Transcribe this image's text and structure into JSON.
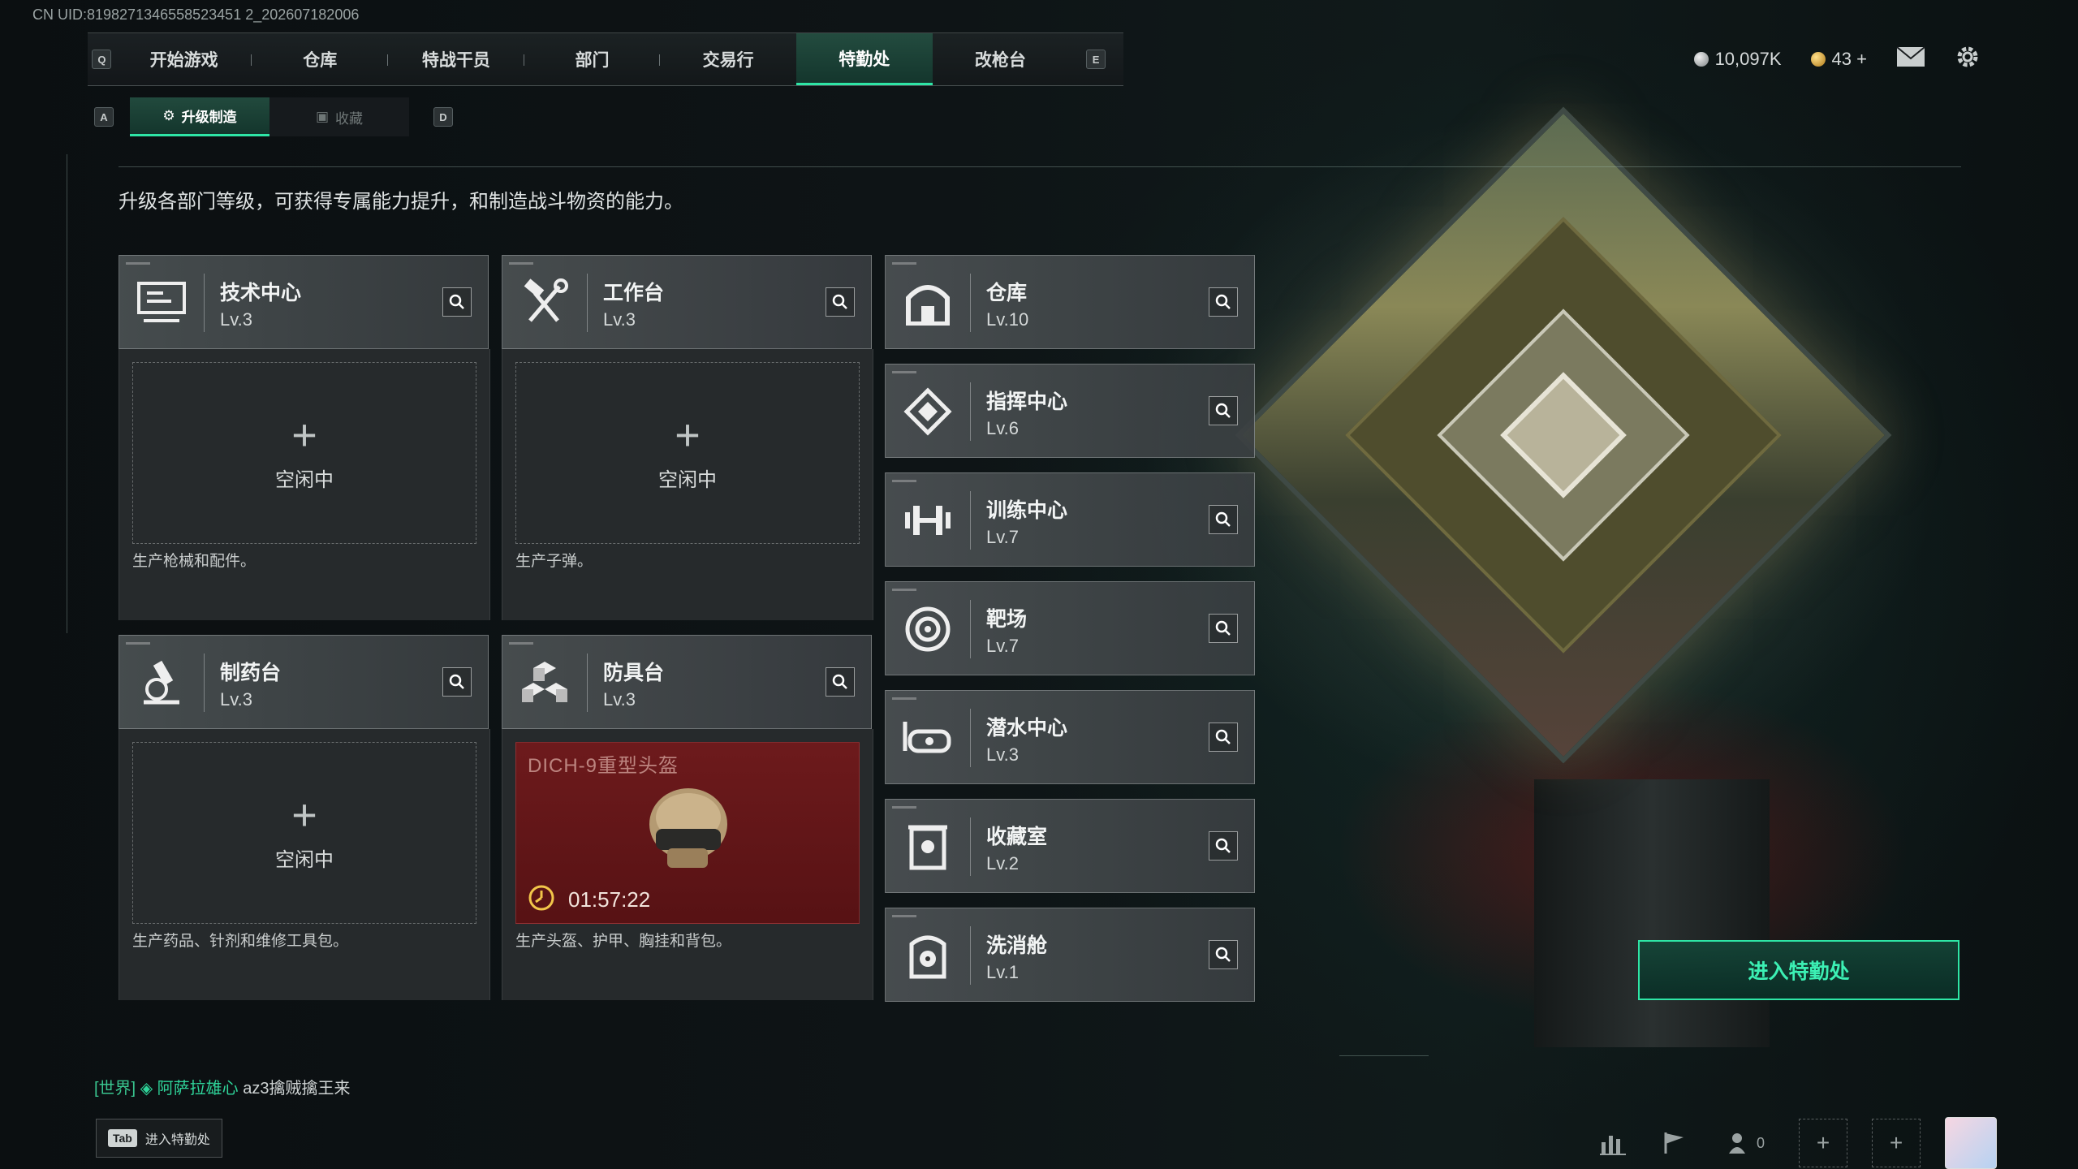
{
  "uid": "CN UID:8198271346558523451 2_202607182006",
  "keys": {
    "prev_main": "Q",
    "next_main": "E",
    "prev_sub": "A",
    "next_sub": "D"
  },
  "nav": {
    "tabs": [
      "开始游戏",
      "仓库",
      "特战干员",
      "部门",
      "交易行",
      "特勤处",
      "改枪台"
    ],
    "active": "特勤处"
  },
  "currency": {
    "silver": "10,097K",
    "gold": "43",
    "gold_add": "+"
  },
  "subtabs": {
    "upgrade": "升级制造",
    "collection": "收藏"
  },
  "description": "升级各部门等级，可获得专属能力提升，和制造战斗物资的能力。",
  "left_cards": [
    {
      "name": "技术中心",
      "level": "Lv.3",
      "icon": "computer-terminal-icon",
      "slot": {
        "plus": "+",
        "idle": "空闲中"
      },
      "desc": "生产枪械和配件。"
    },
    {
      "name": "工作台",
      "level": "Lv.3",
      "icon": "hammer-wrench-icon",
      "slot": {
        "plus": "+",
        "idle": "空闲中"
      },
      "desc": "生产子弹。"
    },
    {
      "name": "制药台",
      "level": "Lv.3",
      "icon": "microscope-icon",
      "slot": {
        "plus": "+",
        "idle": "空闲中"
      },
      "desc": "生产药品、针剂和维修工具包。"
    },
    {
      "name": "防具台",
      "level": "Lv.3",
      "icon": "cubes-icon",
      "crafting": {
        "item": "DICH-9重型头盔",
        "timer": "01:57:22"
      },
      "desc": "生产头盔、护甲、胸挂和背包。"
    }
  ],
  "right_cards": [
    {
      "name": "仓库",
      "level": "Lv.10",
      "icon": "warehouse-icon"
    },
    {
      "name": "指挥中心",
      "level": "Lv.6",
      "icon": "command-chip-icon"
    },
    {
      "name": "训练中心",
      "level": "Lv.7",
      "icon": "dumbbell-icon"
    },
    {
      "name": "靶场",
      "level": "Lv.7",
      "icon": "target-icon"
    },
    {
      "name": "潜水中心",
      "level": "Lv.3",
      "icon": "diving-mask-icon"
    },
    {
      "name": "收藏室",
      "level": "Lv.2",
      "icon": "display-case-icon"
    },
    {
      "name": "洗消舱",
      "level": "Lv.1",
      "icon": "radiation-chamber-icon"
    }
  ],
  "enter_button": "进入特勤处",
  "chat": {
    "channel": "[世界]",
    "name": "阿萨拉雄心",
    "message": "az3擒贼擒王来"
  },
  "tab_hint": {
    "key": "Tab",
    "label": "进入特勤处"
  },
  "friends_count": "0",
  "colors": {
    "accent": "#2ee6a6",
    "craft_bg": "#6d1a1c"
  }
}
